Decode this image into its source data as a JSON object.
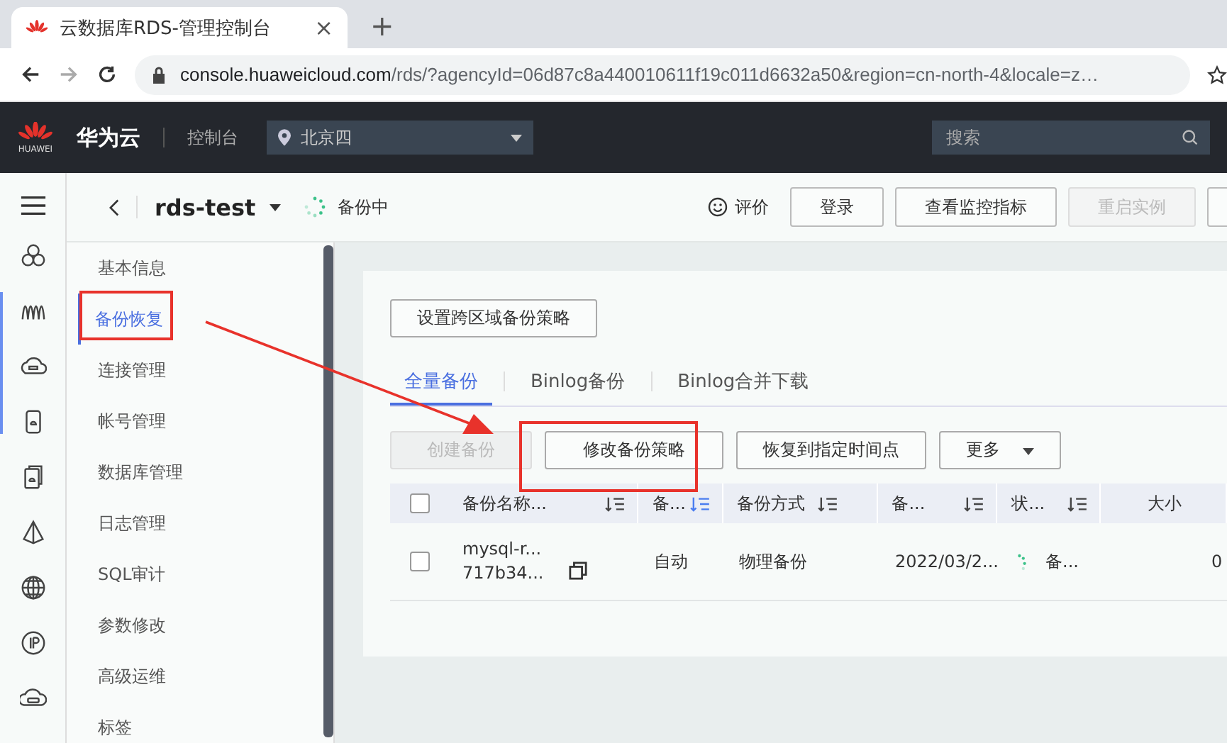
{
  "browser": {
    "tab_title": "云数据库RDS-管理控制台",
    "close": "×",
    "new_tab": "+",
    "url_host": "console.huaweicloud.com",
    "url_rest": "/rds/?agencyId=06d87c8a440010611f19c011d6632a50&region=cn-north-4&locale=z…"
  },
  "header": {
    "logo_text": "HUAWEI",
    "brand": "华为云",
    "console": "控制台",
    "region": "北京四",
    "search": {
      "placeholder": "搜索"
    }
  },
  "instance": {
    "name": "rds-test",
    "status": "备份中",
    "rate": "评价"
  },
  "instance_buttons": [
    {
      "label": "登录",
      "disabled": false
    },
    {
      "label": "查看监控指标",
      "disabled": false
    },
    {
      "label": "重启实例",
      "disabled": true
    }
  ],
  "nav": {
    "items": [
      {
        "label": "基本信息",
        "selected": false
      },
      {
        "label": "备份恢复",
        "selected": true
      },
      {
        "label": "连接管理",
        "selected": false
      },
      {
        "label": "帐号管理",
        "selected": false
      },
      {
        "label": "数据库管理",
        "selected": false
      },
      {
        "label": "日志管理",
        "selected": false
      },
      {
        "label": "SQL审计",
        "selected": false
      },
      {
        "label": "参数修改",
        "selected": false
      },
      {
        "label": "高级运维",
        "selected": false
      },
      {
        "label": "标签",
        "selected": false
      }
    ]
  },
  "cross_region_button": "设置跨区域备份策略",
  "tabs": [
    {
      "label": "全量备份",
      "selected": true
    },
    {
      "label": "Binlog备份",
      "selected": false
    },
    {
      "label": "Binlog合并下载",
      "selected": false
    }
  ],
  "actions": [
    {
      "label": "创建备份",
      "disabled": true,
      "dropdown": false
    },
    {
      "label": "修改备份策略",
      "disabled": false,
      "dropdown": false
    },
    {
      "label": "恢复到指定时间点",
      "disabled": false,
      "dropdown": false
    },
    {
      "label": "更多",
      "disabled": false,
      "dropdown": true
    }
  ],
  "table": {
    "select_all_checked": false,
    "columns": [
      {
        "label": "备份名称...",
        "sorted": false
      },
      {
        "label": "备...",
        "sorted": true
      },
      {
        "label": "备份方式",
        "sorted": false
      },
      {
        "label": "备...",
        "sorted": false
      },
      {
        "label": "状...",
        "sorted": false
      },
      {
        "label": "大小"
      }
    ],
    "rows": [
      {
        "checked": false,
        "name_lines": [
          "mysql-r...",
          "717b34..."
        ],
        "type": "自动",
        "method": "物理备份",
        "time": "2022/03/2...",
        "status": "备...",
        "size": "0"
      }
    ]
  }
}
